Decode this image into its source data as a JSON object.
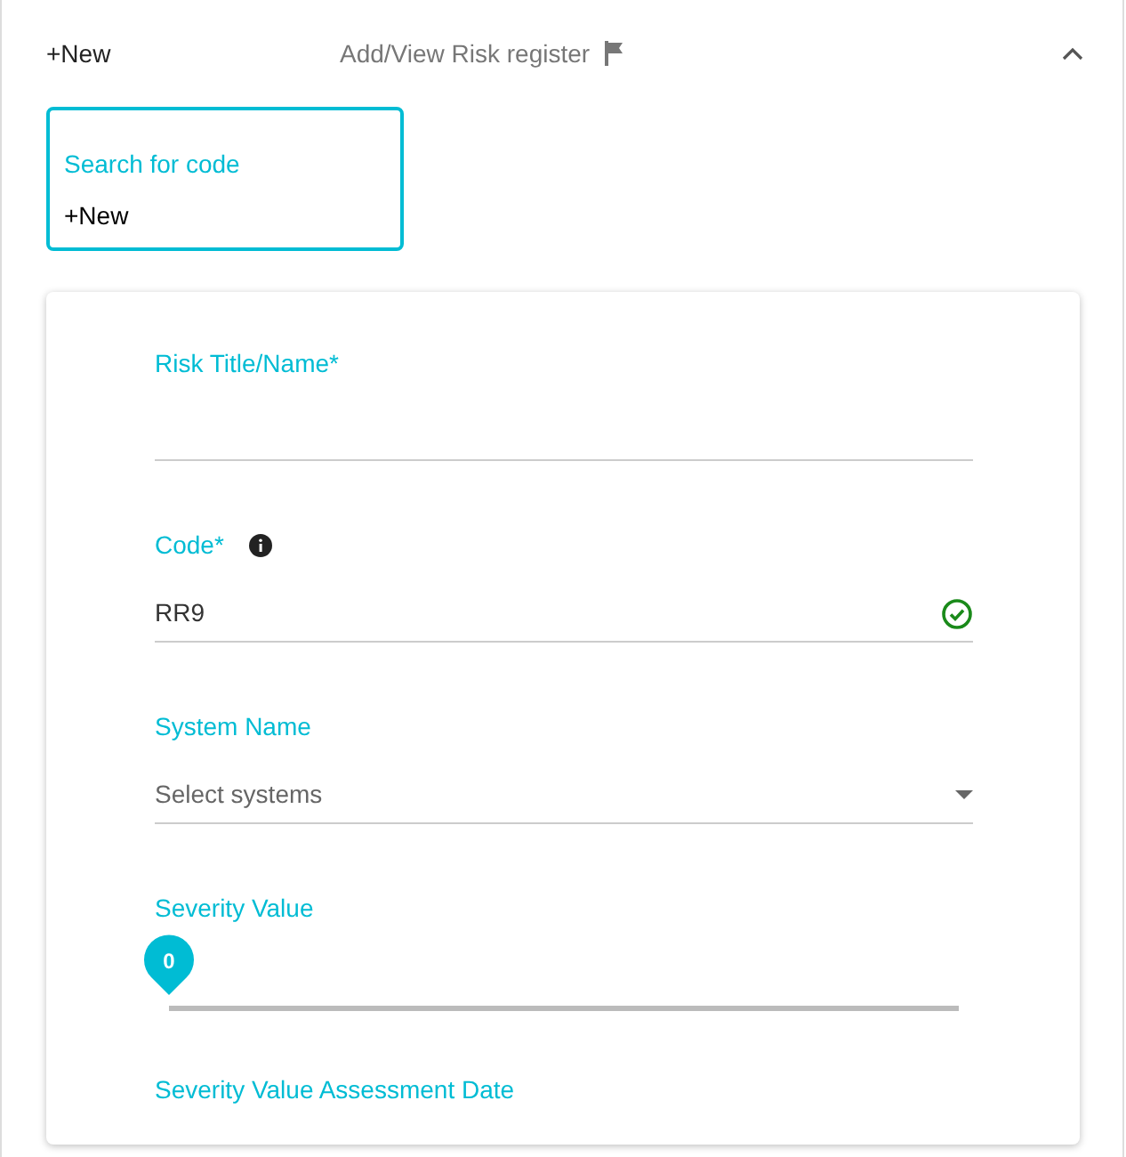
{
  "header": {
    "title": "+New",
    "subtitle": "Add/View Risk register",
    "expanded": true
  },
  "search": {
    "label": "Search for code",
    "value": "+New",
    "focused": true
  },
  "fields": [
    {
      "kind": "text",
      "label": "Risk Title/Name*"
    },
    {
      "kind": "text",
      "label": "Code*",
      "info": true,
      "value": "RR9",
      "valid": true
    },
    {
      "kind": "select",
      "label": "System Name",
      "placeholder": "Select systems"
    },
    {
      "kind": "slider",
      "label": "Severity Value",
      "level": 0,
      "reading": "0"
    },
    {
      "kind": "heading",
      "label": "Severity Value Assessment Date"
    }
  ]
}
